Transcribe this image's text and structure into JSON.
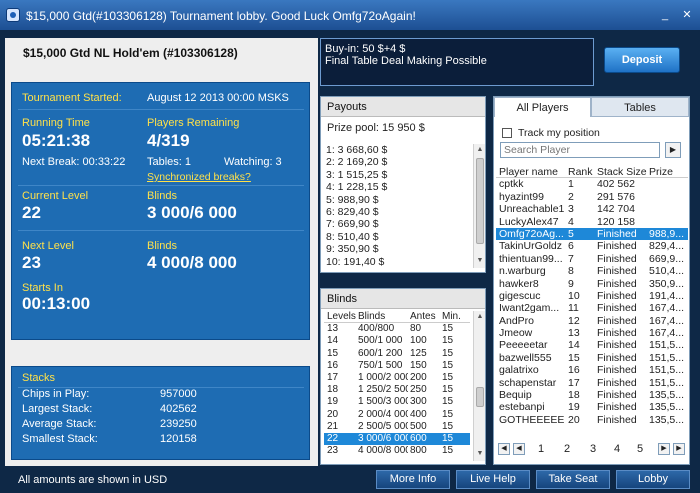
{
  "window": {
    "title": "$15,000 Gtd(#103306128) Tournament lobby. Good Luck Omfg72oAgain!",
    "minimize": "_",
    "close": "✕"
  },
  "tournament": {
    "name": "$15,000 Gtd NL Hold'em (#103306128)",
    "started_label": "Tournament Started:",
    "started_value": "August 12 2013  00:00 MSKS",
    "running_label": "Running Time",
    "running_value": "05:21:38",
    "players_label": "Players Remaining",
    "players_value": "4/319",
    "next_break": "Next Break: 00:33:22",
    "tables": "Tables: 1",
    "watching": "Watching: 3",
    "sync_breaks": "Synchronized breaks?",
    "current_level_label": "Current Level",
    "current_level_value": "22",
    "current_blinds_label": "Blinds",
    "current_blinds_value": "3 000/6 000",
    "next_level_label": "Next Level",
    "next_level_value": "23",
    "next_blinds_label": "Blinds",
    "next_blinds_value": "4 000/8 000",
    "starts_in_label": "Starts In",
    "starts_in_value": "00:13:00"
  },
  "stacks": {
    "title": "Stacks",
    "rows": [
      {
        "label": "Chips in Play:",
        "value": "957000"
      },
      {
        "label": "Largest Stack:",
        "value": "402562"
      },
      {
        "label": "Average Stack:",
        "value": "239250"
      },
      {
        "label": "Smallest Stack:",
        "value": "120158"
      }
    ]
  },
  "buyin": {
    "line1": "Buy-in: 50 $+4 $",
    "line2": "Final Table Deal Making Possible",
    "deposit": "Deposit"
  },
  "payouts": {
    "title": "Payouts",
    "prize_pool": "Prize pool: 15 950 $",
    "items": [
      "1: 3 668,60 $",
      "2: 2 169,20 $",
      "3: 1 515,25 $",
      "4: 1 228,15 $",
      "5: 988,90 $",
      "6: 829,40 $",
      "7: 669,90 $",
      "8: 510,40 $",
      "9: 350,90 $",
      "10: 191,40 $"
    ]
  },
  "blinds": {
    "title": "Blinds",
    "headers": [
      "Levels",
      "Blinds",
      "Antes",
      "Min."
    ],
    "rows": [
      [
        "13",
        "400/800",
        "80",
        "15"
      ],
      [
        "14",
        "500/1 000",
        "100",
        "15"
      ],
      [
        "15",
        "600/1 200",
        "125",
        "15"
      ],
      [
        "16",
        "750/1 500",
        "150",
        "15"
      ],
      [
        "17",
        "1 000/2 000",
        "200",
        "15"
      ],
      [
        "18",
        "1 250/2 500",
        "250",
        "15"
      ],
      [
        "19",
        "1 500/3 000",
        "300",
        "15"
      ],
      [
        "20",
        "2 000/4 000",
        "400",
        "15"
      ],
      [
        "21",
        "2 500/5 000",
        "500",
        "15"
      ],
      [
        "22",
        "3 000/6 000",
        "600",
        "15"
      ],
      [
        "23",
        "4 000/8 000",
        "800",
        "15"
      ]
    ],
    "selected_index": 9
  },
  "players": {
    "tab_all": "All Players",
    "tab_tables": "Tables",
    "track": "Track my position",
    "search_placeholder": "Search Player",
    "headers": [
      "Player name",
      "Rank",
      "Stack Size",
      "Prize"
    ],
    "rows": [
      [
        "cptkk",
        "1",
        "402 562",
        ""
      ],
      [
        "hyazint99",
        "2",
        "291 576",
        ""
      ],
      [
        "Unreachable1",
        "3",
        "142 704",
        ""
      ],
      [
        "LuckyAlex47",
        "4",
        "120 158",
        ""
      ],
      [
        "Omfg72oAg...",
        "5",
        "Finished",
        "988,9..."
      ],
      [
        "TakinUrGoldz",
        "6",
        "Finished",
        "829,4..."
      ],
      [
        "thientuan99...",
        "7",
        "Finished",
        "669,9..."
      ],
      [
        "n.warburg",
        "8",
        "Finished",
        "510,4..."
      ],
      [
        "hawker8",
        "9",
        "Finished",
        "350,9..."
      ],
      [
        "gigescuc",
        "10",
        "Finished",
        "191,4..."
      ],
      [
        "Iwant2gam...",
        "11",
        "Finished",
        "167,4..."
      ],
      [
        "AndPro",
        "12",
        "Finished",
        "167,4..."
      ],
      [
        "Jmeow",
        "13",
        "Finished",
        "167,4..."
      ],
      [
        "Peeeeetar",
        "14",
        "Finished",
        "151,5..."
      ],
      [
        "bazwell555",
        "15",
        "Finished",
        "151,5..."
      ],
      [
        "galatrixo",
        "16",
        "Finished",
        "151,5..."
      ],
      [
        "schapenstar",
        "17",
        "Finished",
        "151,5..."
      ],
      [
        "Bequip",
        "18",
        "Finished",
        "135,5..."
      ],
      [
        "estebanpi",
        "19",
        "Finished",
        "135,5..."
      ],
      [
        "GOTHEEEEE...",
        "20",
        "Finished",
        "135,5..."
      ]
    ],
    "selected_index": 4,
    "pages": [
      "1",
      "2",
      "3",
      "4",
      "5"
    ]
  },
  "footer": {
    "note": "All amounts are shown in USD",
    "more_info": "More Info",
    "live_help": "Live Help",
    "take_seat": "Take Seat",
    "lobby": "Lobby"
  },
  "colors": {
    "accent_blue": "#1e6cb3",
    "label_yellow": "#ffe14a",
    "selection": "#1e88d8"
  }
}
